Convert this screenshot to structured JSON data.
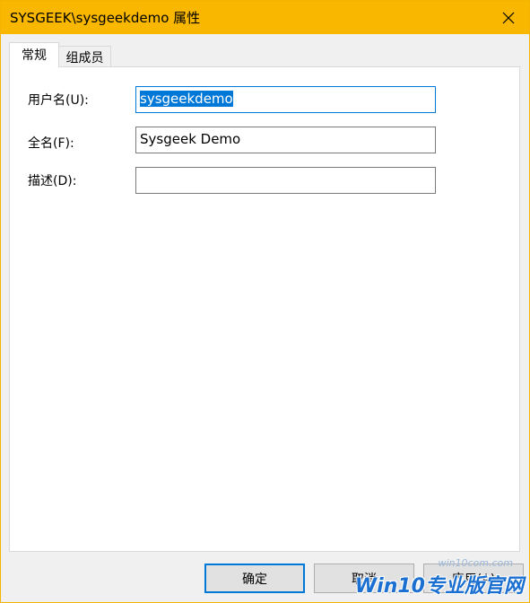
{
  "window": {
    "title": "SYSGEEK\\sysgeekdemo 属性",
    "titlebar_color": "#f9b700"
  },
  "tabs": [
    {
      "label": "常规",
      "active": true
    },
    {
      "label": "组成员",
      "active": false
    }
  ],
  "form": {
    "username_label": "用户名(U):",
    "username_value": "sysgeekdemo",
    "fullname_label": "全名(F):",
    "fullname_value": "Sysgeek Demo",
    "description_label": "描述(D):",
    "description_value": ""
  },
  "buttons": {
    "ok": "确定",
    "cancel": "取消",
    "apply": "应用(A)"
  },
  "watermark": {
    "text": "Win10专业版官网",
    "sub": "win10com.com"
  },
  "colors": {
    "accent": "#0078d7",
    "watermark": "#1a6fd0"
  },
  "icons": {
    "close": "close-icon"
  }
}
